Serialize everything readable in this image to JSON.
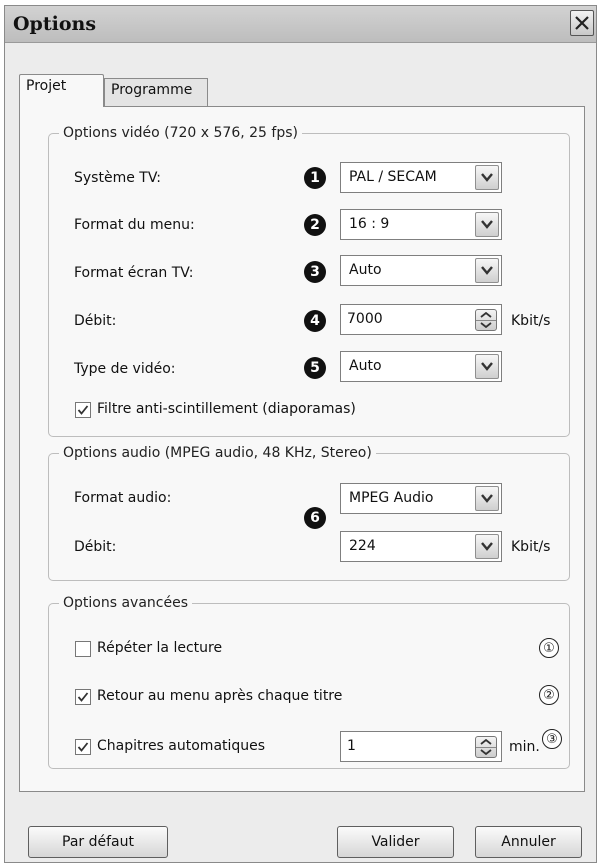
{
  "window": {
    "title": "Options"
  },
  "tabs": [
    {
      "label": "Projet",
      "active": true
    },
    {
      "label": "Programme",
      "active": false
    }
  ],
  "video": {
    "legend": "Options vidéo (720 x 576, 25 fps)",
    "rows": [
      {
        "label": "Système TV:",
        "marker": "1",
        "value": "PAL / SECAM"
      },
      {
        "label": "Format du menu:",
        "marker": "2",
        "value": "16 : 9"
      },
      {
        "label": "Format écran TV:",
        "marker": "3",
        "value": "Auto"
      },
      {
        "label": "Débit:",
        "marker": "4",
        "value": "7000",
        "unit": "Kbit/s"
      },
      {
        "label": "Type de vidéo:",
        "marker": "5",
        "value": "Auto"
      }
    ],
    "checkbox": {
      "label": "Filtre anti-scintillement (diaporamas)",
      "checked": true
    }
  },
  "audio": {
    "legend": "Options audio (MPEG audio, 48 KHz, Stereo)",
    "marker": "6",
    "format_label": "Format audio:",
    "format_value": "MPEG Audio",
    "bitrate_label": "Débit:",
    "bitrate_value": "224",
    "bitrate_unit": "Kbit/s"
  },
  "advanced": {
    "legend": "Options avancées",
    "items": [
      {
        "label": "Répéter la lecture",
        "checked": false,
        "marker": "①"
      },
      {
        "label": "Retour au menu après chaque titre",
        "checked": true,
        "marker": "②"
      },
      {
        "label": "Chapitres automatiques",
        "checked": true,
        "marker": "③",
        "value": "1",
        "unit": "min."
      }
    ]
  },
  "buttons": {
    "default": "Par défaut",
    "ok": "Valider",
    "cancel": "Annuler"
  },
  "icons": {
    "close": "close-icon",
    "dropdown": "chevron-down-icon",
    "spin": "spin-arrows-icon",
    "check": "checkmark-icon"
  }
}
